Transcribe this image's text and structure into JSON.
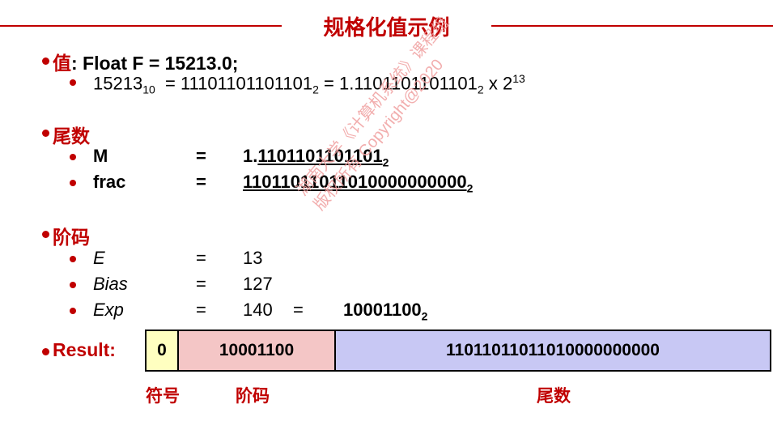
{
  "title": "规格化值示例",
  "value": {
    "heading_prefix": "值",
    "heading_rest": ": Float F = 15213.0;",
    "line": {
      "a": "15213",
      "a_sub": "10",
      "eq1": "=",
      "b": "11101101101101",
      "b_sub": "2",
      "eq2": "=",
      "c": "1.1101101101101",
      "c_sub": "2",
      "times": "x 2",
      "exp": "13"
    }
  },
  "mantissa": {
    "heading": "尾数",
    "m_label": "M",
    "m_eq": "=",
    "m_prefix": "1.",
    "m_underlined": "1101101101101",
    "m_sub": "2",
    "frac_label": "frac",
    "frac_eq": "=",
    "frac_underlined": "11011011011010000000000",
    "frac_sub": "2"
  },
  "exponent": {
    "heading": "阶码",
    "rows": [
      {
        "label": "E",
        "eq": "=",
        "value": "13"
      },
      {
        "label": "Bias",
        "eq": "=",
        "value": "127"
      },
      {
        "label": "Exp",
        "eq": "=",
        "value": "140",
        "eq2": "=",
        "binary": "10001100",
        "binary_sub": "2"
      }
    ]
  },
  "result": {
    "heading": "Result:",
    "sign": "0",
    "exp_bits": "10001100",
    "frac_bits": "11011011011010000000000",
    "labels": {
      "sign": "符号",
      "exp": "阶码",
      "frac": "尾数"
    }
  },
  "watermark": {
    "line1": "湖南大学《计算机系统》课程组",
    "line2": "版权所有 Copyright@2020"
  },
  "colors": {
    "accent": "#c00000",
    "sign_box": "#ffffc0",
    "exp_box": "#f4c6c6",
    "frac_box": "#c8c8f4"
  }
}
